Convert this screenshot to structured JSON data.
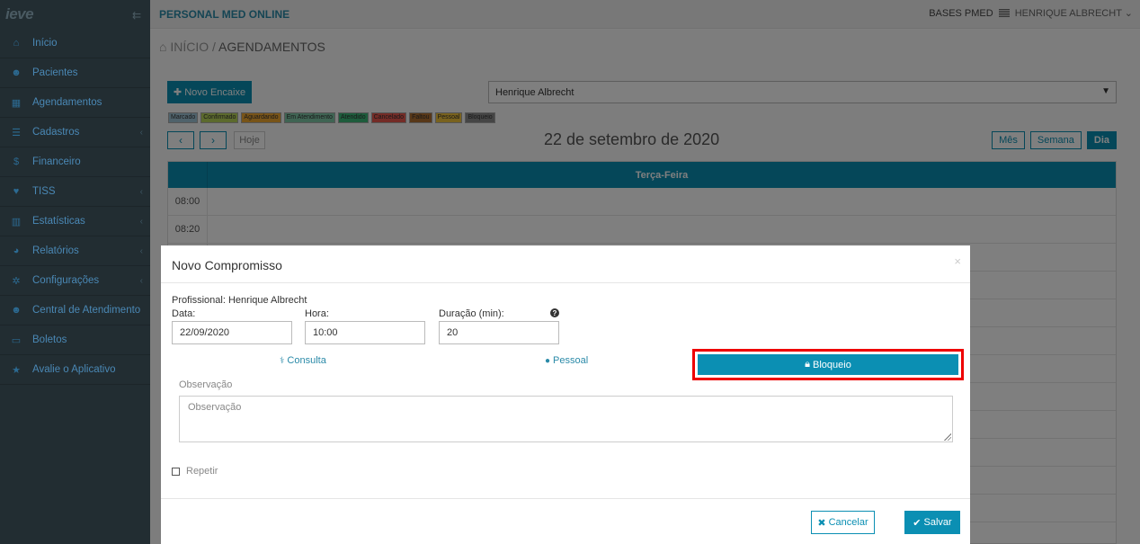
{
  "sidebar": {
    "logo": "ieve",
    "collapse_icon": "list-icon",
    "items": [
      {
        "label": "Início",
        "icon": "home-icon"
      },
      {
        "label": "Pacientes",
        "icon": "users-icon"
      },
      {
        "label": "Agendamentos",
        "icon": "calendar-icon"
      },
      {
        "label": "Cadastros",
        "icon": "list-icon"
      },
      {
        "label": "Financeiro",
        "icon": "dollar-icon"
      },
      {
        "label": "TISS",
        "icon": "heart-icon"
      },
      {
        "label": "Estatísticas",
        "icon": "bar-chart-icon"
      },
      {
        "label": "Relatórios",
        "icon": "pie-chart-icon"
      },
      {
        "label": "Configurações",
        "icon": "gear-icon"
      },
      {
        "label": "Central de Atendimento",
        "icon": "users-icon"
      },
      {
        "label": "Boletos",
        "icon": "money-icon"
      },
      {
        "label": "Avalie o Aplicativo",
        "icon": "star-icon"
      }
    ]
  },
  "topbar": {
    "app_title": "PERSONAL MED ONLINE",
    "bases": "BASES PMED",
    "user": "HENRIQUE ALBRECHT"
  },
  "breadcrumb": {
    "home": "INÍCIO",
    "separator": "/",
    "current": "AGENDAMENTOS"
  },
  "toolbar": {
    "new_slot_label": "Novo Encaixe",
    "professional_selected": "Henrique Albrecht"
  },
  "legend": [
    {
      "label": "Marcado",
      "color": "#9fc5d6"
    },
    {
      "label": "Confirmado",
      "color": "#b8d45a"
    },
    {
      "label": "Aguardando",
      "color": "#f0a830"
    },
    {
      "label": "Em Atendimento",
      "color": "#7ec8a6"
    },
    {
      "label": "Atendido",
      "color": "#3cb878"
    },
    {
      "label": "Cancelado",
      "color": "#e8584f"
    },
    {
      "label": "Faltou",
      "color": "#b07032"
    },
    {
      "label": "Pessoal",
      "color": "#f2c53d"
    },
    {
      "label": "Bloqueio",
      "color": "#8a8a8a"
    }
  ],
  "calendar": {
    "today_label": "Hoje",
    "title": "22 de setembro de 2020",
    "views": [
      "Mês",
      "Semana",
      "Dia"
    ],
    "active_view": "Dia",
    "day_header": "Terça-Feira",
    "times": [
      "08:00",
      "08:20",
      "",
      "",
      "",
      "",
      "",
      "",
      "",
      "",
      "",
      "",
      ""
    ]
  },
  "modal": {
    "title": "Novo Compromisso",
    "professional": "Profissional: Henrique Albrecht",
    "date_label": "Data:",
    "date_value": "22/09/2020",
    "time_label": "Hora:",
    "time_value": "10:00",
    "duration_label": "Duração (min):",
    "duration_value": "20",
    "types": {
      "consulta": "Consulta",
      "pessoal": "Pessoal",
      "bloqueio": "Bloqueio"
    },
    "obs_label": "Observação",
    "obs_placeholder": "Observação",
    "repeat_label": "Repetir",
    "cancel_label": "Cancelar",
    "save_label": "Salvar"
  }
}
